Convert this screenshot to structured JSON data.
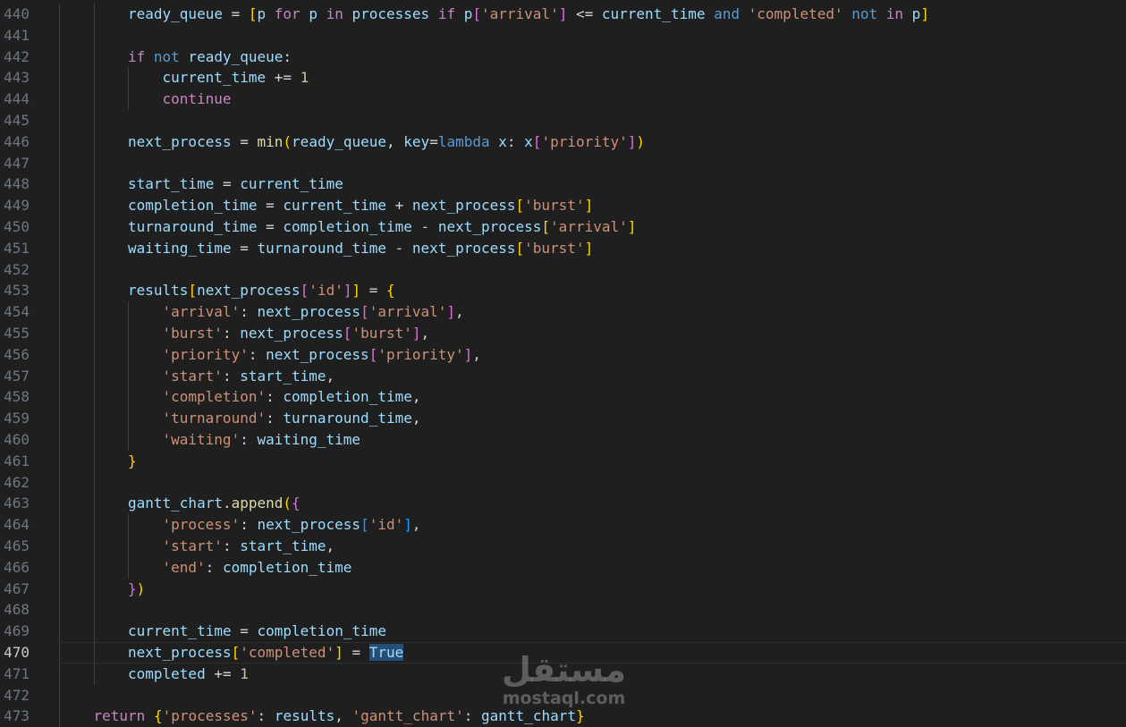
{
  "editor": {
    "current_line": 470,
    "lines": [
      {
        "n": "440",
        "indent": 2,
        "tokens": [
          [
            "var",
            "ready_queue"
          ],
          [
            "op",
            " = "
          ],
          [
            "b1",
            "["
          ],
          [
            "var",
            "p "
          ],
          [
            "kw",
            "for"
          ],
          [
            "var",
            " p "
          ],
          [
            "kw",
            "in"
          ],
          [
            "var",
            " processes "
          ],
          [
            "kw",
            "if"
          ],
          [
            "var",
            " p"
          ],
          [
            "b2",
            "["
          ],
          [
            "str",
            "'arrival'"
          ],
          [
            "b2",
            "]"
          ],
          [
            "op",
            " <= "
          ],
          [
            "var",
            "current_time "
          ],
          [
            "blue",
            "and"
          ],
          [
            "str",
            " 'completed'"
          ],
          [
            "blue",
            " not"
          ],
          [
            "kw",
            " in"
          ],
          [
            "var",
            " p"
          ],
          [
            "b1",
            "]"
          ]
        ]
      },
      {
        "n": "441",
        "indent": 0,
        "tokens": []
      },
      {
        "n": "442",
        "indent": 2,
        "tokens": [
          [
            "kw",
            "if"
          ],
          [
            "blue",
            " not"
          ],
          [
            "var",
            " ready_queue"
          ],
          [
            "op",
            ":"
          ]
        ]
      },
      {
        "n": "443",
        "indent": 3,
        "tokens": [
          [
            "var",
            "current_time"
          ],
          [
            "op",
            " += "
          ],
          [
            "num",
            "1"
          ]
        ]
      },
      {
        "n": "444",
        "indent": 3,
        "tokens": [
          [
            "kw",
            "continue"
          ]
        ]
      },
      {
        "n": "445",
        "indent": 0,
        "tokens": []
      },
      {
        "n": "446",
        "indent": 2,
        "tokens": [
          [
            "var",
            "next_process"
          ],
          [
            "op",
            " = "
          ],
          [
            "fn",
            "min"
          ],
          [
            "b1",
            "("
          ],
          [
            "var",
            "ready_queue"
          ],
          [
            "op",
            ", "
          ],
          [
            "var",
            "key"
          ],
          [
            "op",
            "="
          ],
          [
            "blue",
            "lambda"
          ],
          [
            "var",
            " x"
          ],
          [
            "op",
            ": "
          ],
          [
            "var",
            "x"
          ],
          [
            "b2",
            "["
          ],
          [
            "str",
            "'priority'"
          ],
          [
            "b2",
            "]"
          ],
          [
            "b1",
            ")"
          ]
        ]
      },
      {
        "n": "447",
        "indent": 0,
        "tokens": []
      },
      {
        "n": "448",
        "indent": 2,
        "tokens": [
          [
            "var",
            "start_time"
          ],
          [
            "op",
            " = "
          ],
          [
            "var",
            "current_time"
          ]
        ]
      },
      {
        "n": "449",
        "indent": 2,
        "tokens": [
          [
            "var",
            "completion_time"
          ],
          [
            "op",
            " = "
          ],
          [
            "var",
            "current_time"
          ],
          [
            "op",
            " + "
          ],
          [
            "var",
            "next_process"
          ],
          [
            "b1",
            "["
          ],
          [
            "str",
            "'burst'"
          ],
          [
            "b1",
            "]"
          ]
        ]
      },
      {
        "n": "450",
        "indent": 2,
        "tokens": [
          [
            "var",
            "turnaround_time"
          ],
          [
            "op",
            " = "
          ],
          [
            "var",
            "completion_time"
          ],
          [
            "op",
            " - "
          ],
          [
            "var",
            "next_process"
          ],
          [
            "b1",
            "["
          ],
          [
            "str",
            "'arrival'"
          ],
          [
            "b1",
            "]"
          ]
        ]
      },
      {
        "n": "451",
        "indent": 2,
        "tokens": [
          [
            "var",
            "waiting_time"
          ],
          [
            "op",
            " = "
          ],
          [
            "var",
            "turnaround_time"
          ],
          [
            "op",
            " - "
          ],
          [
            "var",
            "next_process"
          ],
          [
            "b1",
            "["
          ],
          [
            "str",
            "'burst'"
          ],
          [
            "b1",
            "]"
          ]
        ]
      },
      {
        "n": "452",
        "indent": 0,
        "tokens": []
      },
      {
        "n": "453",
        "indent": 2,
        "tokens": [
          [
            "var",
            "results"
          ],
          [
            "b1",
            "["
          ],
          [
            "var",
            "next_process"
          ],
          [
            "b2",
            "["
          ],
          [
            "str",
            "'id'"
          ],
          [
            "b2",
            "]"
          ],
          [
            "b1",
            "]"
          ],
          [
            "op",
            " = "
          ],
          [
            "b1",
            "{"
          ]
        ]
      },
      {
        "n": "454",
        "indent": 3,
        "tokens": [
          [
            "str",
            "'arrival'"
          ],
          [
            "op",
            ": "
          ],
          [
            "var",
            "next_process"
          ],
          [
            "b2",
            "["
          ],
          [
            "str",
            "'arrival'"
          ],
          [
            "b2",
            "]"
          ],
          [
            "op",
            ","
          ]
        ]
      },
      {
        "n": "455",
        "indent": 3,
        "tokens": [
          [
            "str",
            "'burst'"
          ],
          [
            "op",
            ": "
          ],
          [
            "var",
            "next_process"
          ],
          [
            "b2",
            "["
          ],
          [
            "str",
            "'burst'"
          ],
          [
            "b2",
            "]"
          ],
          [
            "op",
            ","
          ]
        ]
      },
      {
        "n": "456",
        "indent": 3,
        "tokens": [
          [
            "str",
            "'priority'"
          ],
          [
            "op",
            ": "
          ],
          [
            "var",
            "next_process"
          ],
          [
            "b2",
            "["
          ],
          [
            "str",
            "'priority'"
          ],
          [
            "b2",
            "]"
          ],
          [
            "op",
            ","
          ]
        ]
      },
      {
        "n": "457",
        "indent": 3,
        "tokens": [
          [
            "str",
            "'start'"
          ],
          [
            "op",
            ": "
          ],
          [
            "var",
            "start_time"
          ],
          [
            "op",
            ","
          ]
        ]
      },
      {
        "n": "458",
        "indent": 3,
        "tokens": [
          [
            "str",
            "'completion'"
          ],
          [
            "op",
            ": "
          ],
          [
            "var",
            "completion_time"
          ],
          [
            "op",
            ","
          ]
        ]
      },
      {
        "n": "459",
        "indent": 3,
        "tokens": [
          [
            "str",
            "'turnaround'"
          ],
          [
            "op",
            ": "
          ],
          [
            "var",
            "turnaround_time"
          ],
          [
            "op",
            ","
          ]
        ]
      },
      {
        "n": "460",
        "indent": 3,
        "tokens": [
          [
            "str",
            "'waiting'"
          ],
          [
            "op",
            ": "
          ],
          [
            "var",
            "waiting_time"
          ]
        ]
      },
      {
        "n": "461",
        "indent": 2,
        "tokens": [
          [
            "b1",
            "}"
          ]
        ]
      },
      {
        "n": "462",
        "indent": 0,
        "tokens": []
      },
      {
        "n": "463",
        "indent": 2,
        "tokens": [
          [
            "var",
            "gantt_chart"
          ],
          [
            "op",
            "."
          ],
          [
            "fn",
            "append"
          ],
          [
            "b1",
            "("
          ],
          [
            "b2",
            "{"
          ]
        ]
      },
      {
        "n": "464",
        "indent": 3,
        "tokens": [
          [
            "str",
            "'process'"
          ],
          [
            "op",
            ": "
          ],
          [
            "var",
            "next_process"
          ],
          [
            "b3",
            "["
          ],
          [
            "str",
            "'id'"
          ],
          [
            "b3",
            "]"
          ],
          [
            "op",
            ","
          ]
        ]
      },
      {
        "n": "465",
        "indent": 3,
        "tokens": [
          [
            "str",
            "'start'"
          ],
          [
            "op",
            ": "
          ],
          [
            "var",
            "start_time"
          ],
          [
            "op",
            ","
          ]
        ]
      },
      {
        "n": "466",
        "indent": 3,
        "tokens": [
          [
            "str",
            "'end'"
          ],
          [
            "op",
            ": "
          ],
          [
            "var",
            "completion_time"
          ]
        ]
      },
      {
        "n": "467",
        "indent": 2,
        "tokens": [
          [
            "b2",
            "}"
          ],
          [
            "b1",
            ")"
          ]
        ]
      },
      {
        "n": "468",
        "indent": 0,
        "tokens": []
      },
      {
        "n": "469",
        "indent": 2,
        "tokens": [
          [
            "var",
            "current_time"
          ],
          [
            "op",
            " = "
          ],
          [
            "var",
            "completion_time"
          ]
        ]
      },
      {
        "n": "470",
        "indent": 2,
        "tokens": [
          [
            "var",
            "next_process"
          ],
          [
            "b1",
            "["
          ],
          [
            "str",
            "'completed'"
          ],
          [
            "b1",
            "]"
          ],
          [
            "op",
            " = "
          ],
          [
            "hl",
            "True"
          ]
        ]
      },
      {
        "n": "471",
        "indent": 2,
        "tokens": [
          [
            "var",
            "completed"
          ],
          [
            "op",
            " += "
          ],
          [
            "num",
            "1"
          ]
        ]
      },
      {
        "n": "472",
        "indent": 0,
        "tokens": []
      },
      {
        "n": "473",
        "indent": 1,
        "tokens": [
          [
            "kw",
            "return"
          ],
          [
            "op",
            " "
          ],
          [
            "b1",
            "{"
          ],
          [
            "str",
            "'processes'"
          ],
          [
            "op",
            ": "
          ],
          [
            "var",
            "results"
          ],
          [
            "op",
            ", "
          ],
          [
            "str",
            "'gantt_chart'"
          ],
          [
            "op",
            ": "
          ],
          [
            "var",
            "gantt_chart"
          ],
          [
            "b1",
            "}"
          ]
        ]
      }
    ]
  },
  "watermark": {
    "arabic": "مستقل",
    "latin": "mostaql.com"
  }
}
